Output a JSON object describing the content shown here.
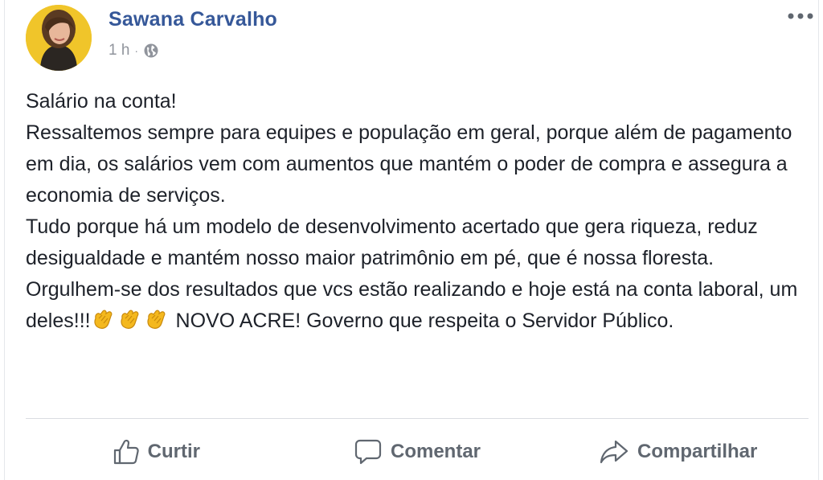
{
  "post": {
    "author": "Sawana Carvalho",
    "time": "1 h",
    "separator": "·",
    "privacy_icon": "globe-icon",
    "more_icon": "more-options-icon",
    "lines": [
      "Salário na conta!",
      "Ressaltemos sempre para equipes e população em geral, porque além de pagamento em dia, os salários vem com aumentos que mantém o poder de compra e assegura a economia de serviços.",
      "Tudo porque há um modelo de desenvolvimento acertado que gera riqueza, reduz desigualdade e mantém nosso maior patrimônio em pé, que é nossa floresta.",
      "Orgulhem-se dos resultados que vcs estão realizando e hoje está na conta laboral, um deles!!!"
    ],
    "emoji_icon": "clapping-hands-icon",
    "closing_text": " NOVO ACRE! Governo que respeita o Servidor Público."
  },
  "actions": {
    "like_label": "Curtir",
    "comment_label": "Comentar",
    "share_label": "Compartilhar",
    "like_icon": "thumbs-up-icon",
    "comment_icon": "comment-bubble-icon",
    "share_icon": "share-arrow-icon"
  },
  "colors": {
    "author_name": "#365899",
    "body_text": "#1d2129",
    "meta_text": "#90949c",
    "action_text": "#606770",
    "divider": "#dadde1"
  }
}
